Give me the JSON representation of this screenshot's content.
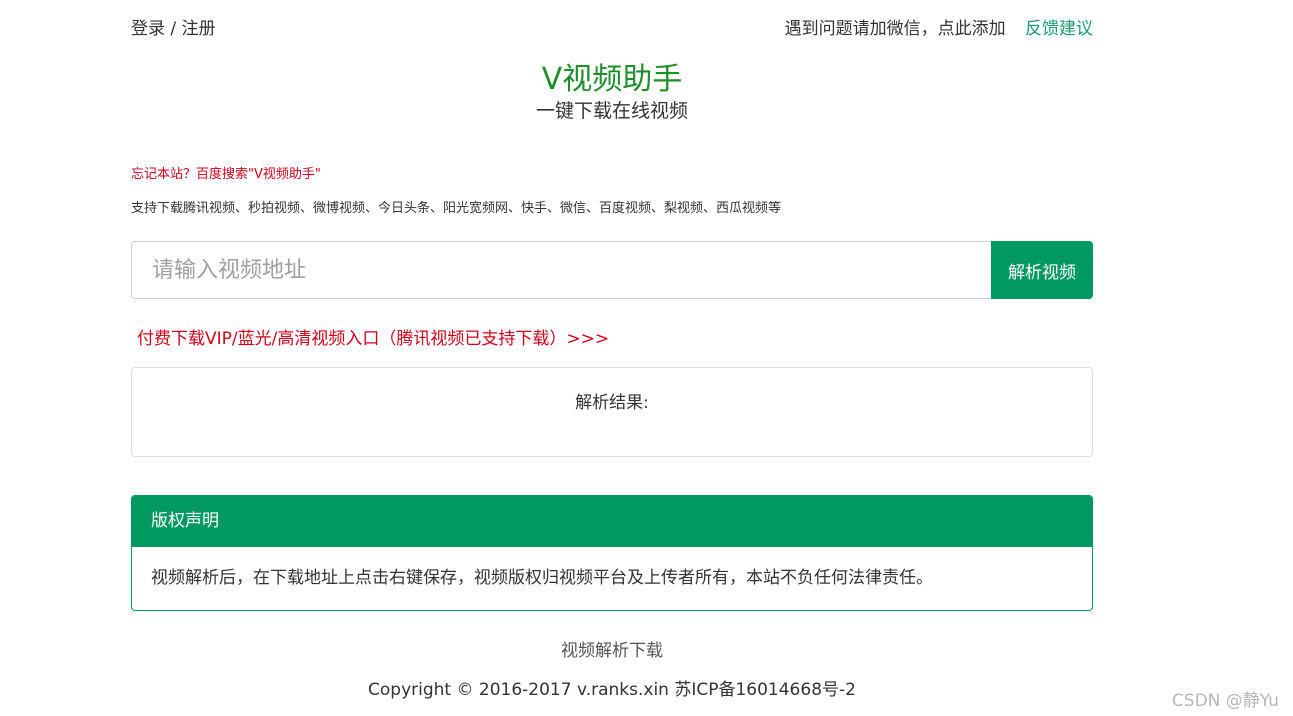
{
  "header": {
    "login_label": "登录 / 注册",
    "wechat_label": "遇到问题请加微信，点此添加",
    "feedback_label": "反馈建议"
  },
  "hero": {
    "title": "V视频助手",
    "subtitle": "一键下载在线视频"
  },
  "notice": {
    "hint": "忘记本站？百度搜索\"V视频助手\"",
    "supported": "支持下载腾讯视频、秒拍视频、微博视频、今日头条、阳光宽频网、快手、微信、百度视频、梨视频、西瓜视频等"
  },
  "search": {
    "placeholder": "请输入视频地址",
    "value": "",
    "button_label": "解析视频"
  },
  "vip_link": "付费下载VIP/蓝光/高清视频入口（腾讯视频已支持下载）>>>",
  "result": {
    "label": "解析结果:"
  },
  "copyright_panel": {
    "heading": "版权声明",
    "body": "视频解析后，在下载地址上点击右键保存，视频版权归视频平台及上传者所有，本站不负任何法律责任。"
  },
  "footer": {
    "link_label": "视频解析下载",
    "copyright": "Copyright © 2016-2017 v.ranks.xin 苏ICP备16014668号-2"
  },
  "watermark": "CSDN @静Yu",
  "colors": {
    "brand_green": "#009961",
    "title_green": "#1e8f2a",
    "alert_red": "#d0021b",
    "link_green": "#1a9e6e"
  }
}
